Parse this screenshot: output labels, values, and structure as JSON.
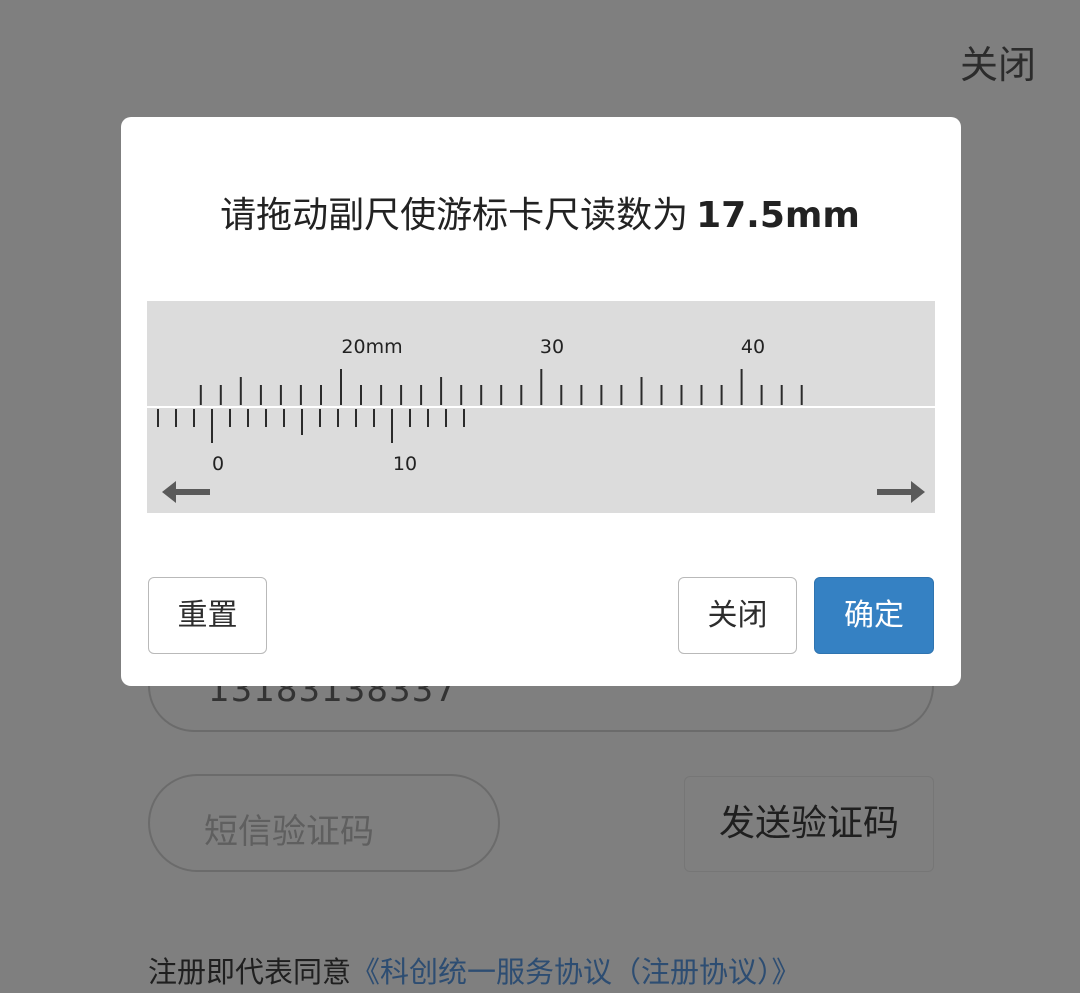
{
  "page": {
    "close_label": "关闭"
  },
  "form": {
    "phone_value": "13183138337",
    "sms_placeholder": "短信验证码",
    "send_code_label": "发送验证码",
    "agreement_text": "注册即代表同意",
    "agreement_link": "《科创统一服务协议（注册协议）》"
  },
  "modal": {
    "instruction": "请拖动副尺使游标卡尺读数为",
    "target_reading": "17.5mm",
    "main_scale": {
      "labels": [
        {
          "value": 20,
          "text": "20mm"
        },
        {
          "value": 30,
          "text": "30"
        },
        {
          "value": 40,
          "text": "40"
        }
      ]
    },
    "vernier_scale": {
      "labels": [
        {
          "value": 0,
          "text": "0"
        },
        {
          "value": 10,
          "text": "10"
        }
      ]
    },
    "left_arrow_icon": "arrow-left-icon",
    "right_arrow_icon": "arrow-right-icon",
    "buttons": {
      "reset": "重置",
      "close": "关闭",
      "confirm": "确定"
    }
  },
  "colors": {
    "overlay": "#7f7f7f",
    "caliper_bg": "#dcdcdc",
    "confirm_button": "#3581c3"
  }
}
